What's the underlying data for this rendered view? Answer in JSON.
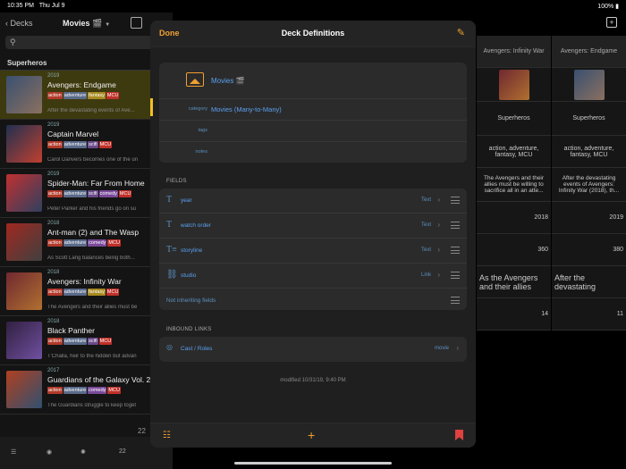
{
  "status": {
    "time": "10:35 PM",
    "date": "Thu Jul 9",
    "battery": "100%"
  },
  "left": {
    "back_label": "Decks",
    "title": "Movies 🎬",
    "section": "Superheros",
    "count": "22",
    "bottom_count": "22",
    "movies": [
      {
        "year": "2019",
        "name": "Avengers: Endgame",
        "tags": [
          "action",
          "adventure",
          "fantasy",
          "MCU"
        ],
        "desc": "After the devastating events of Ave...",
        "colors": [
          "#3a5070",
          "#8a7060"
        ]
      },
      {
        "year": "2019",
        "name": "Captain Marvel",
        "tags": [
          "action",
          "adventure",
          "scifi",
          "MCU"
        ],
        "desc": "Carol Danvers becomes one of the un",
        "colors": [
          "#203050",
          "#c04030"
        ]
      },
      {
        "year": "2019",
        "name": "Spider-Man: Far From Home",
        "tags": [
          "action",
          "adventure",
          "scifi",
          "comedy",
          "MCU"
        ],
        "desc": "Peter Parker and his friends go on su",
        "colors": [
          "#c03030",
          "#304060"
        ]
      },
      {
        "year": "2018",
        "name": "Ant-man (2) and The Wasp",
        "tags": [
          "action",
          "adventure",
          "comedy",
          "MCU"
        ],
        "desc": "As Scott Lang balances being both...",
        "colors": [
          "#a02820",
          "#404040"
        ]
      },
      {
        "year": "2018",
        "name": "Avengers: Infinity War",
        "tags": [
          "action",
          "adventure",
          "fantasy",
          "MCU"
        ],
        "desc": "The Avengers and their allies must be",
        "colors": [
          "#702830",
          "#b07030"
        ]
      },
      {
        "year": "2018",
        "name": "Black Panther",
        "tags": [
          "action",
          "adventure",
          "scifi",
          "MCU"
        ],
        "desc": "T'Challa, heir to the hidden but advan",
        "colors": [
          "#302040",
          "#7050a0"
        ]
      },
      {
        "year": "2017",
        "name": "Guardians of the Galaxy Vol. 2",
        "tags": [
          "action",
          "adventure",
          "comedy",
          "MCU"
        ],
        "desc": "The Guardians struggle to keep toget",
        "colors": [
          "#b04020",
          "#305070"
        ]
      }
    ]
  },
  "table": {
    "columns": [
      {
        "header": "Avengers: Infinity War",
        "category": "Superheros",
        "tags": "action, adventure, fantasy, MCU",
        "story": "The Avengers and their allies must be willing to sacrifice all in an atte...",
        "year": "2018",
        "order": "360",
        "big": "As the Avengers and their allies",
        "num": "14",
        "colors": [
          "#702830",
          "#b07030"
        ]
      },
      {
        "header": "Avengers: Endgame",
        "category": "Superheros",
        "tags": "action, adventure, fantasy, MCU",
        "story": "After the devastating events of Avengers: Infinity War (2018), th...",
        "year": "2019",
        "order": "380",
        "big": "After the devastating",
        "num": "11",
        "colors": [
          "#3a5070",
          "#8a7060"
        ]
      }
    ]
  },
  "modal": {
    "done": "Done",
    "title": "Deck Definitions",
    "deck_name": "Movies 🎬",
    "category_label": "category",
    "category_value": "Movies (Many-to-Many)",
    "tags_label": "tags",
    "notes_label": "notes",
    "fields_header": "FIELDS",
    "fields": [
      {
        "icon": "T",
        "name": "year",
        "type": "Text"
      },
      {
        "icon": "T",
        "name": "watch order",
        "type": "Text"
      },
      {
        "icon": "T≡",
        "name": "storyline",
        "type": "Text"
      },
      {
        "icon": "⛓",
        "name": "studio",
        "type": "Link"
      }
    ],
    "not_inheriting": "Not inheriting fields",
    "inbound_header": "INBOUND LINKS",
    "link_name": "Cast / Roles",
    "link_target": "movie",
    "modified": "modified 10/31/19, 9:40 PM"
  }
}
